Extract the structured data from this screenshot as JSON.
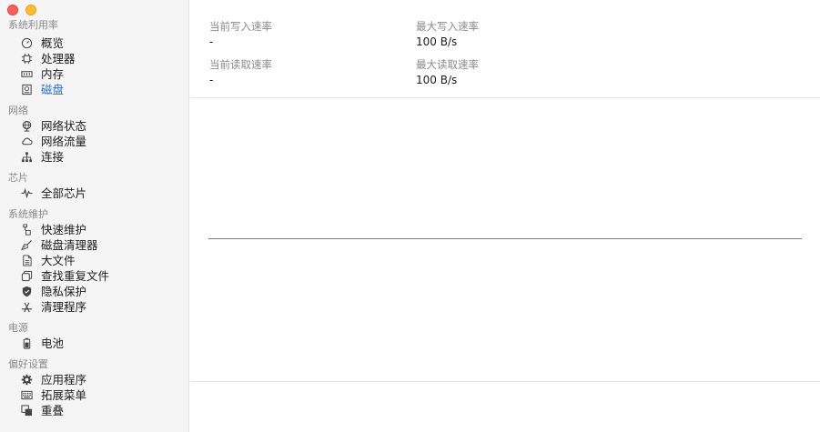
{
  "sidebar": {
    "groups": [
      {
        "title": "系统利用率",
        "items": [
          {
            "label": "概览",
            "icon": "gauge-icon"
          },
          {
            "label": "处理器",
            "icon": "cpu-chip-icon"
          },
          {
            "label": "内存",
            "icon": "memory-icon"
          },
          {
            "label": "磁盘",
            "icon": "disk-icon"
          }
        ]
      },
      {
        "title": "网络",
        "items": [
          {
            "label": "网络状态",
            "icon": "globe-icon"
          },
          {
            "label": "网络流量",
            "icon": "cloud-icon"
          },
          {
            "label": "连接",
            "icon": "network-tree-icon"
          }
        ]
      },
      {
        "title": "芯片",
        "items": [
          {
            "label": "全部芯片",
            "icon": "waveform-icon"
          }
        ]
      },
      {
        "title": "系统维护",
        "items": [
          {
            "label": "快速维护",
            "icon": "tools-icon"
          },
          {
            "label": "磁盘清理器",
            "icon": "broom-icon"
          },
          {
            "label": "大文件",
            "icon": "document-icon"
          },
          {
            "label": "查找重复文件",
            "icon": "duplicate-icon"
          },
          {
            "label": "隐私保护",
            "icon": "shield-icon"
          },
          {
            "label": "清理程序",
            "icon": "app-store-icon"
          }
        ]
      },
      {
        "title": "电源",
        "items": [
          {
            "label": "电池",
            "icon": "battery-icon"
          }
        ]
      },
      {
        "title": "偏好设置",
        "items": [
          {
            "label": "应用程序",
            "icon": "gear-icon"
          },
          {
            "label": "拓展菜单",
            "icon": "keyboard-icon"
          },
          {
            "label": "重叠",
            "icon": "overlap-icon"
          }
        ]
      }
    ]
  },
  "main": {
    "stats": {
      "current_write_label": "当前写入速率",
      "current_write_value": "-",
      "max_write_label": "最大写入速率",
      "max_write_value": "100 B/s",
      "current_read_label": "当前读取速率",
      "current_read_value": "-",
      "max_read_label": "最大读取速率",
      "max_read_value": "100 B/s"
    }
  },
  "colors": {
    "accent": "#2a6fd6",
    "close": "#fe5f57",
    "minimize": "#febc2e"
  }
}
